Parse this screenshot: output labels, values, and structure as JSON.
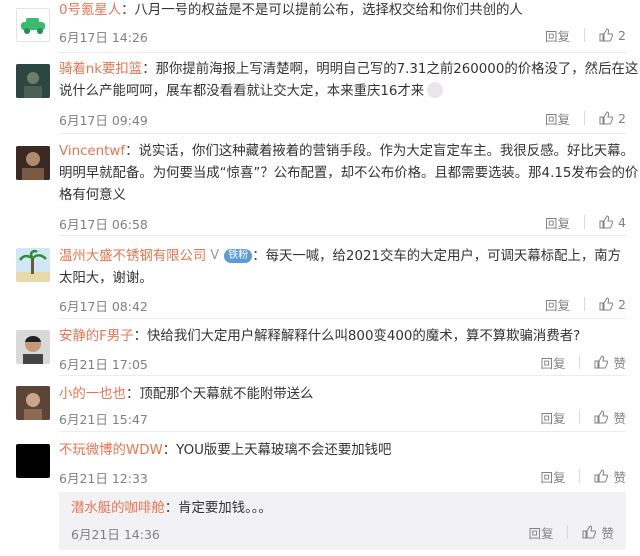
{
  "comments": [
    {
      "user": "0号氪星人",
      "text": "八月一号的权益是不是可以提前公布，选择权交给和你们共创的人",
      "time": "6月17日 14:26",
      "reply_label": "回复",
      "likes": "2"
    },
    {
      "user": "骑着nk要扣篮",
      "text_line1": "那你提前海报上写清楚啊，明明自己写的7.31之前260000的价格没了，然后在这",
      "text_line2": "说什么产能呵呵，展车都没看看就让交大定，本来重庆16才来",
      "time": "6月17日 09:49",
      "reply_label": "回复",
      "likes": "2"
    },
    {
      "user": "Vincentwf",
      "text_line1": "说实话，你们这种藏着掖着的营销手段。作为大定盲定车主。我很反感。好比天幕。",
      "text_line2": "明明早就配备。为何要当成“惊喜”？公布配置，却不公布价格。且都需要选装。那4.15发布会的价",
      "text_line3": "格有何意义",
      "time": "6月17日 06:58",
      "reply_label": "回复",
      "likes": "4"
    },
    {
      "user": "温州大盛不锈钢有限公司",
      "badge_v": "V",
      "badge_fan": "铁粉",
      "text_line1": "每天一喊，给2021交车的大定用户，可调天幕标配上，南方",
      "text_line2": "太阳大，谢谢。",
      "time": "6月17日 08:42",
      "reply_label": "回复",
      "likes": "2"
    },
    {
      "user": "安静的F男子",
      "text": "快给我们大定用户解释解释什么叫800变400的魔术，算不算欺骗消费者?",
      "time": "6月21日 17:05",
      "reply_label": "回复",
      "likes": "赞"
    },
    {
      "user": "小的一也也",
      "text": "顶配那个天幕就不能附带送么",
      "time": "6月21日 15:47",
      "reply_label": "回复",
      "likes": "赞"
    },
    {
      "user": "不玩微博的WDW",
      "text": "YOU版要上天幕玻璃不会还要加钱吧",
      "time": "6月21日 12:33",
      "reply_label": "回复",
      "likes": "赞",
      "sub_reply": {
        "user": "潜水艇的咖啡舱",
        "text": "肯定要加钱。。。",
        "time": "6月21日 14:36",
        "reply_label": "回复",
        "likes": "赞"
      }
    }
  ]
}
